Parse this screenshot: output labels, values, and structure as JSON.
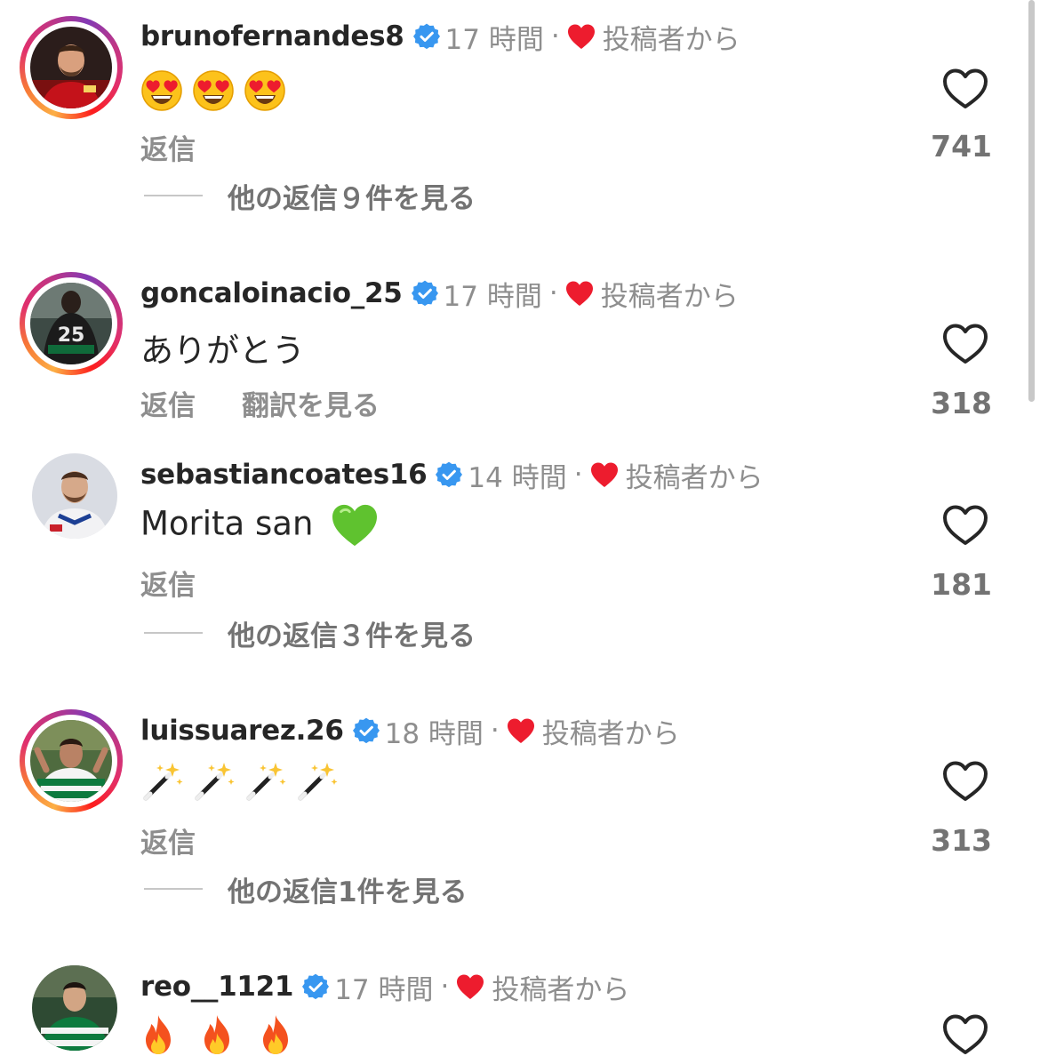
{
  "labels": {
    "reply": "返信",
    "translate": "翻訳を見る",
    "from_author": "投稿者から",
    "separator": "·"
  },
  "comments": [
    {
      "username": "brunofernandes8",
      "time": "17 時間",
      "body_emoji": "heart-eyes-emoji x3",
      "likes": "741",
      "view_replies": "他の返信９件を見る",
      "avatar_ring": true
    },
    {
      "username": "goncaloinacio_25",
      "time": "17 時間",
      "body": "ありがとう",
      "likes": "318",
      "avatar_ring": true
    },
    {
      "username": "sebastiancoates16",
      "time": "14 時間",
      "body": "Morita san",
      "body_emoji": "green-heart-emoji",
      "likes": "181",
      "view_replies": "他の返信３件を見る",
      "avatar_ring": false
    },
    {
      "username": "luissuarez.26",
      "time": "18 時間",
      "body_emoji": "magic-wand-emoji x4",
      "likes": "313",
      "view_replies": "他の返信1件を見る",
      "avatar_ring": true
    },
    {
      "username": "reo__1121",
      "time": "17 時間",
      "body_emoji": "fire-emoji x3",
      "avatar_ring": false
    }
  ],
  "colors": {
    "verified_blue": "#3897f0",
    "author_heart_red": "#ed1c2e",
    "secondary_text": "#8e8e8e"
  }
}
